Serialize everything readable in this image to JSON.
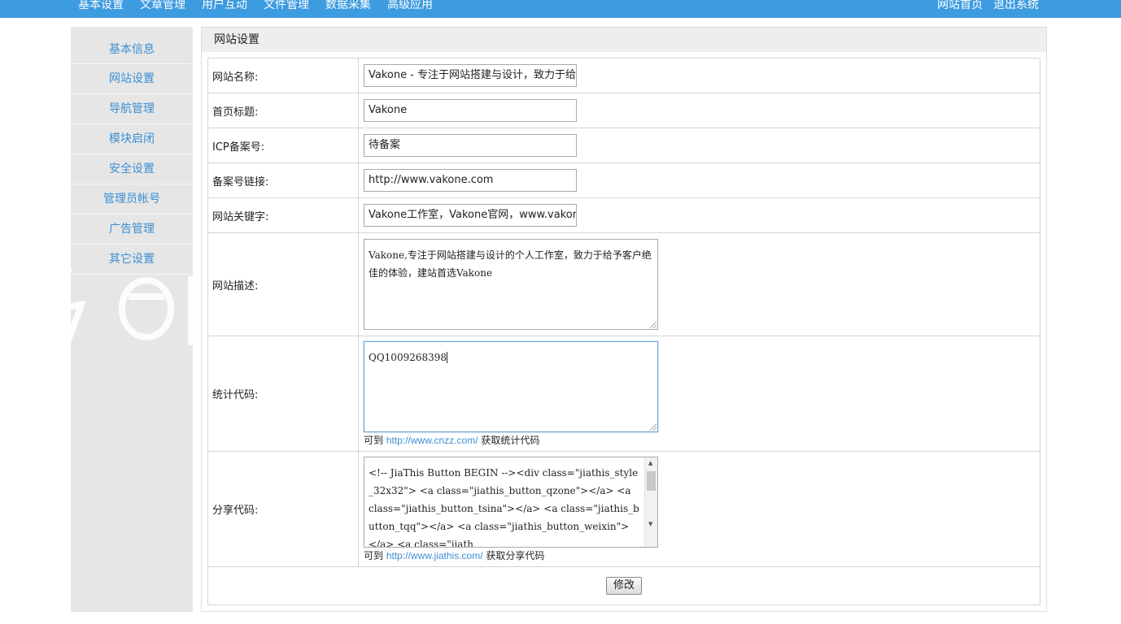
{
  "topnav": {
    "items": [
      "基本设置",
      "文章管理",
      "用户互动",
      "文件管理",
      "数据采集",
      "高级应用"
    ],
    "right": [
      "网站首页",
      "退出系统"
    ]
  },
  "sidebar": {
    "items": [
      "基本信息",
      "网站设置",
      "导航管理",
      "模块启闭",
      "安全设置",
      "管理员帐号",
      "广告管理",
      "其它设置"
    ]
  },
  "panel": {
    "title": "网站设置",
    "fields": {
      "site_name": {
        "label": "网站名称:",
        "value": "Vakone - 专注于网站搭建与设计，致力于给"
      },
      "home_title": {
        "label": "首页标题:",
        "value": "Vakone"
      },
      "icp": {
        "label": "ICP备案号:",
        "value": "待备案"
      },
      "icp_link": {
        "label": "备案号链接:",
        "value": "http://www.vakone.com"
      },
      "keywords": {
        "label": "网站关键字:",
        "value": "Vakone工作室，Vakone官网，www.vakone."
      },
      "description": {
        "label": "网站描述:",
        "value": "Vakone,专注于网站搭建与设计的个人工作室，致力于给予客户绝佳的体验，建站首选Vakone"
      },
      "stats": {
        "label": "统计代码:",
        "value": "QQ1009268398",
        "hint_prefix": "可到",
        "hint_link": "http://www.cnzz.com/",
        "hint_suffix": "获取统计代码"
      },
      "share": {
        "label": "分享代码:",
        "value": "<!-- JiaThis Button BEGIN --><div class=\"jiathis_style_32x32\"> <a class=\"jiathis_button_qzone\"></a> <a class=\"jiathis_button_tsina\"></a> <a class=\"jiathis_button_tqq\"></a>      <a class=\"jiathis_button_weixin\"></a>  <a class=\"jiath",
        "hint_prefix": "可到",
        "hint_link": "http://www.jiathis.com/",
        "hint_suffix": "获取分享代码"
      }
    },
    "submit_label": "修改"
  }
}
